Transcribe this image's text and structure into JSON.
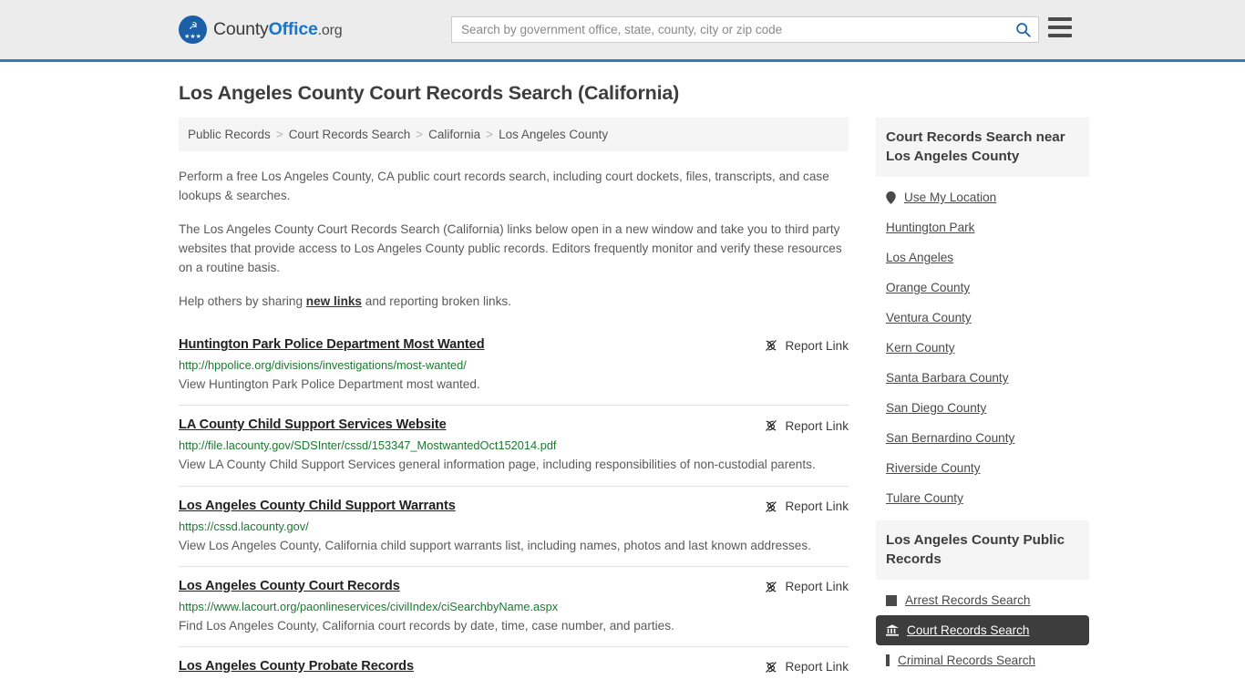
{
  "header": {
    "brand": {
      "part1": "County",
      "part2": "Office",
      "part3": ".org",
      "logo_icon": "eagle-stars-seal-icon"
    },
    "search": {
      "placeholder": "Search by government office, state, county, city or zip code",
      "value": "",
      "search_icon": "search-icon"
    },
    "menu_icon": "hamburger-menu-icon",
    "accent_color": "#337ab7",
    "background_color": "#ececec"
  },
  "page": {
    "title": "Los Angeles County Court Records Search (California)"
  },
  "breadcrumb": {
    "items": [
      {
        "label": "Public Records"
      },
      {
        "label": "Court Records Search"
      },
      {
        "label": "California"
      },
      {
        "label": "Los Angeles County"
      }
    ],
    "separator": ">"
  },
  "intro": {
    "p1": "Perform a free Los Angeles County, CA public court records search, including court dockets, files, transcripts, and case lookups & searches.",
    "p2": "The Los Angeles County Court Records Search (California) links below open in a new window and take you to third party websites that provide access to Los Angeles County public records. Editors frequently monitor and verify these resources on a routine basis.",
    "p3_before": "Help others by sharing ",
    "p3_link": "new links",
    "p3_after": " and reporting broken links."
  },
  "results": {
    "report_label": "Report Link",
    "report_icon": "broken-link-icon",
    "items": [
      {
        "title": "Huntington Park Police Department Most Wanted",
        "url": "http://hppolice.org/divisions/investigations/most-wanted/",
        "description": "View Huntington Park Police Department most wanted."
      },
      {
        "title": "LA County Child Support Services Website",
        "url": "http://file.lacounty.gov/SDSInter/cssd/153347_MostwantedOct152014.pdf",
        "description": "View LA County Child Support Services general information page, including responsibilities of non-custodial parents."
      },
      {
        "title": "Los Angeles County Child Support Warrants",
        "url": "https://cssd.lacounty.gov/",
        "description": "View Los Angeles County, California child support warrants list, including names, photos and last known addresses."
      },
      {
        "title": "Los Angeles County Court Records",
        "url": "https://www.lacourt.org/paonlineservices/civilIndex/ciSearchbyName.aspx",
        "description": "Find Los Angeles County, California court records by date, time, case number, and parties."
      },
      {
        "title": "Los Angeles County Probate Records",
        "url": "",
        "description": ""
      }
    ]
  },
  "sidebar": {
    "nearby": {
      "heading": "Court Records Search near Los Angeles County",
      "items": [
        {
          "label": "Use My Location",
          "icon": "map-pin-icon"
        },
        {
          "label": "Huntington Park",
          "icon": ""
        },
        {
          "label": "Los Angeles",
          "icon": ""
        },
        {
          "label": "Orange County",
          "icon": ""
        },
        {
          "label": "Ventura County",
          "icon": ""
        },
        {
          "label": "Kern County",
          "icon": ""
        },
        {
          "label": "Santa Barbara County",
          "icon": ""
        },
        {
          "label": "San Diego County",
          "icon": ""
        },
        {
          "label": "San Bernardino County",
          "icon": ""
        },
        {
          "label": "Riverside County",
          "icon": ""
        },
        {
          "label": "Tulare County",
          "icon": ""
        }
      ]
    },
    "public_records": {
      "heading": "Los Angeles County Public Records",
      "items": [
        {
          "label": "Arrest Records Search",
          "icon": "square-icon",
          "active": false
        },
        {
          "label": "Court Records Search",
          "icon": "courthouse-icon",
          "active": true
        },
        {
          "label": "Criminal Records Search",
          "icon": "bar-icon",
          "active": false
        }
      ]
    }
  }
}
